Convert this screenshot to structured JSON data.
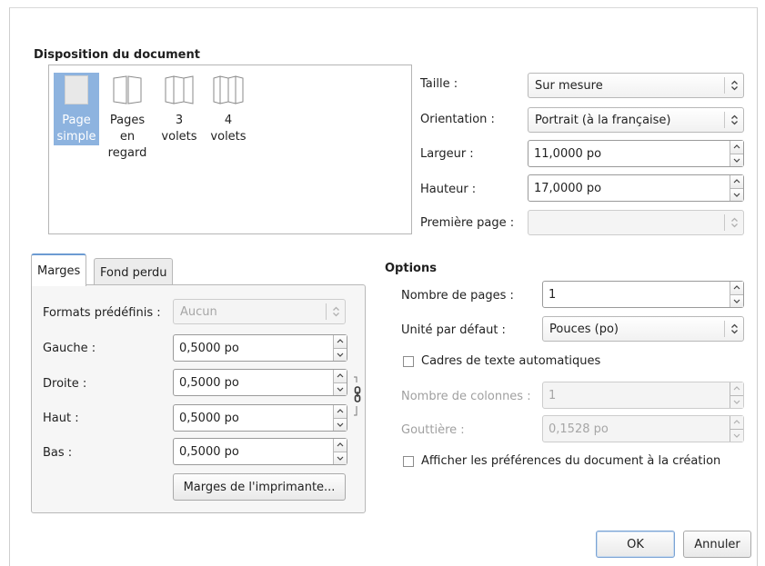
{
  "layout_section": {
    "title": "Disposition du document",
    "items": [
      {
        "label": "Page simple",
        "line1": "Page",
        "line2": "simple",
        "line3": "",
        "selected": true
      },
      {
        "label": "Pages en regard",
        "line1": "Pages",
        "line2": "en",
        "line3": "regard",
        "selected": false
      },
      {
        "label": "3 volets",
        "line1": "3",
        "line2": "volets",
        "line3": "",
        "selected": false
      },
      {
        "label": "4 volets",
        "line1": "4",
        "line2": "volets",
        "line3": "",
        "selected": false
      }
    ]
  },
  "page_settings": {
    "size_label": "Taille :",
    "size_value": "Sur mesure",
    "orientation_label": "Orientation :",
    "orientation_value": "Portrait (à la française)",
    "width_label": "Largeur :",
    "width_value": "11,0000 po",
    "height_label": "Hauteur :",
    "height_value": "17,0000 po",
    "first_page_label": "Première page :",
    "first_page_value": ""
  },
  "tabs": [
    {
      "label": "Marges",
      "active": true
    },
    {
      "label": "Fond perdu",
      "active": false
    }
  ],
  "margins": {
    "presets_label": "Formats prédéfinis :",
    "presets_value": "Aucun",
    "left_label": "Gauche :",
    "left_value": "0,5000 po",
    "right_label": "Droite :",
    "right_value": "0,5000 po",
    "top_label": "Haut :",
    "top_value": "0,5000 po",
    "bottom_label": "Bas :",
    "bottom_value": "0,5000 po",
    "printer_margins_button": "Marges de l'imprimante..."
  },
  "options": {
    "title": "Options",
    "page_count_label": "Nombre de pages :",
    "page_count_value": "1",
    "default_unit_label": "Unité par défaut :",
    "default_unit_value": "Pouces (po)",
    "auto_frames_label": "Cadres de texte automatiques",
    "auto_frames_checked": false,
    "columns_label": "Nombre de colonnes :",
    "columns_value": "1",
    "gutter_label": "Gouttière :",
    "gutter_value": "0,1528 po",
    "show_prefs_label": "Afficher les préférences du document à la création",
    "show_prefs_checked": false
  },
  "footer": {
    "ok_label": "OK",
    "cancel_label": "Annuler"
  },
  "colors": {
    "selection": "#8db3df",
    "tab_accent": "#6c9bd2",
    "default_button_border": "#7aa3d4"
  }
}
